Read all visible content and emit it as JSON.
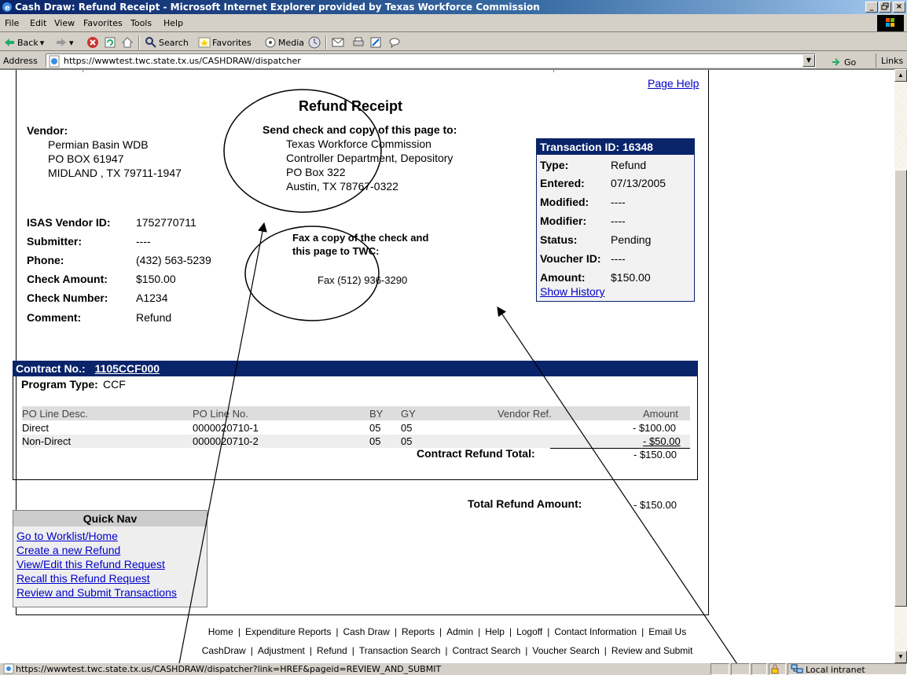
{
  "window": {
    "title": "Cash Draw: Refund Receipt - Microsoft Internet Explorer provided by Texas Workforce Commission",
    "controls": [
      "_",
      "×"
    ]
  },
  "menu": [
    "File",
    "Edit",
    "View",
    "Favorites",
    "Tools",
    "Help"
  ],
  "toolbar": {
    "back": "Back",
    "search": "Search",
    "favorites": "Favorites",
    "media": "Media"
  },
  "address": {
    "label": "Address",
    "url": "https://wwwtest.twc.state.tx.us/CASHDRAW/dispatcher",
    "go": "Go",
    "links": "Links"
  },
  "page": {
    "help_link": "Page Help",
    "title": "Refund Receipt",
    "send_to": {
      "heading": "Send check and copy of this page to:",
      "lines": [
        "Texas Workforce Commission",
        "Controller Department, Depository",
        "PO Box 322",
        "Austin, TX 78767-0322"
      ]
    },
    "fax": {
      "heading_line1": "Fax a copy of the check and",
      "heading_line2": "this page to TWC:",
      "number": "Fax (512) 936-3290"
    },
    "vendor": {
      "label": "Vendor:",
      "lines": [
        "Permian Basin WDB",
        "PO BOX 61947",
        "MIDLAND , TX 79711-1947"
      ]
    },
    "details": [
      {
        "label": "ISAS Vendor ID:",
        "value": "1752770711"
      },
      {
        "label": "Submitter:",
        "value": "----"
      },
      {
        "label": "Phone:",
        "value": "(432) 563-5239"
      },
      {
        "label": "Check Amount:",
        "value": "$150.00"
      },
      {
        "label": "Check Number:",
        "value": "A1234"
      },
      {
        "label": "Comment:",
        "value": "Refund"
      }
    ],
    "transaction": {
      "header": "Transaction ID: 16348",
      "rows": [
        {
          "label": "Type:",
          "value": "Refund"
        },
        {
          "label": "Entered:",
          "value": "07/13/2005"
        },
        {
          "label": "Modified:",
          "value": "----"
        },
        {
          "label": "Modifier:",
          "value": "----"
        },
        {
          "label": "Status:",
          "value": "Pending"
        },
        {
          "label": "Voucher ID:",
          "value": "----"
        },
        {
          "label": "Amount:",
          "value": "$150.00"
        }
      ],
      "history_link": "Show History"
    },
    "contract": {
      "label": "Contract No.:",
      "number": "1105CCF000",
      "program_type_label": "Program Type:",
      "program_type": "CCF",
      "columns": [
        "PO Line Desc.",
        "PO Line No.",
        "BY",
        "GY",
        "Vendor Ref.",
        "Amount"
      ],
      "rows": [
        [
          "Direct",
          "0000020710-1",
          "05",
          "05",
          "",
          "- $100.00"
        ],
        [
          "Non-Direct",
          "0000020710-2",
          "05",
          "05",
          "",
          "- $50.00"
        ]
      ],
      "total_label": "Contract Refund Total:",
      "total": "- $150.00"
    },
    "total_refund_label": "Total Refund Amount:",
    "total_refund": "- $150.00",
    "quick_nav": {
      "title": "Quick Nav",
      "links": [
        "Go to Worklist/Home",
        "Create a new Refund",
        "View/Edit this Refund Request",
        "Recall this Refund Request",
        "Review and Submit Transactions"
      ]
    },
    "footer_row1": [
      "Home",
      "Expenditure Reports",
      "Cash Draw",
      "Reports",
      "Admin",
      "Help",
      "Logoff",
      "Contact Information",
      "Email Us"
    ],
    "footer_row2": [
      "CashDraw",
      "Adjustment",
      "Refund",
      "Transaction Search",
      "Contract Search",
      "Voucher Search",
      "Review and Submit"
    ]
  },
  "status": {
    "url": "https://wwwtest.twc.state.tx.us/CASHDRAW/dispatcher?link=HREF&pageid=REVIEW_AND_SUBMIT",
    "zone": "Local intranet"
  },
  "colors": {
    "title_bar": "#0a246a",
    "header_bar": "#0a246a",
    "link": "#0000cc",
    "chrome": "#d4d0c8"
  }
}
